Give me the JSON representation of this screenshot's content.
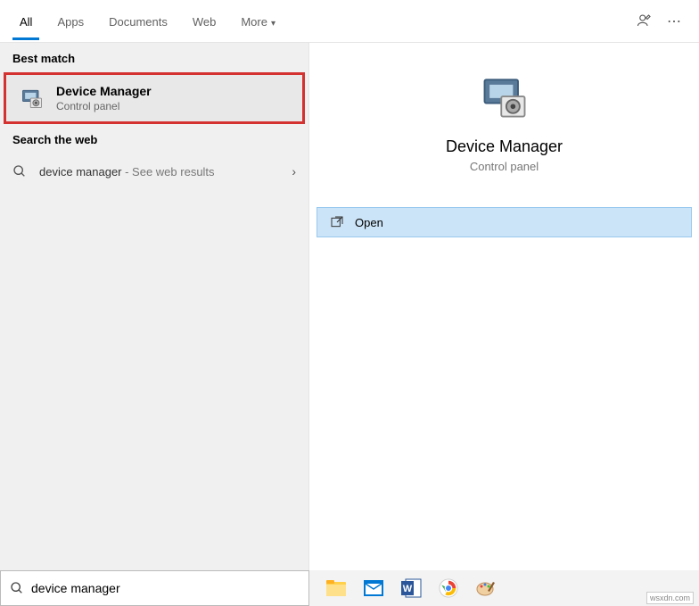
{
  "tabs": {
    "all": "All",
    "apps": "Apps",
    "documents": "Documents",
    "web": "Web",
    "more": "More"
  },
  "sections": {
    "best_match": "Best match",
    "search_web": "Search the web"
  },
  "best_match": {
    "title": "Device Manager",
    "subtitle": "Control panel"
  },
  "web_result": {
    "query": "device manager",
    "suffix": " - See web results"
  },
  "preview": {
    "title": "Device Manager",
    "subtitle": "Control panel"
  },
  "action": {
    "open": "Open"
  },
  "search": {
    "value": "device manager"
  },
  "watermark": "wsxdn.com"
}
